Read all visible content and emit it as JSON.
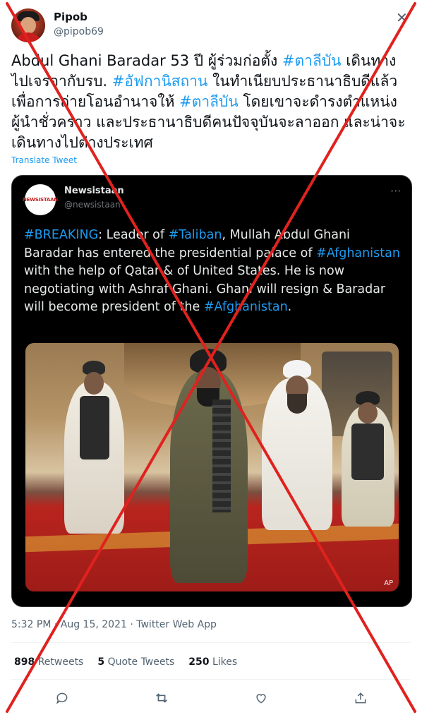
{
  "author": {
    "name": "Pipob",
    "handle": "@pipob69"
  },
  "tweet": {
    "segments": [
      {
        "text": "Abdul Ghani Baradar 53 ปี ผู้ร่วมก่อตั้ง ",
        "tag": false
      },
      {
        "text": "#ตาลีบัน",
        "tag": true
      },
      {
        "text": " เดินทางไปเจรจากับรบ. ",
        "tag": false
      },
      {
        "text": "#อัฟกานิสถาน",
        "tag": true
      },
      {
        "text": " ในทำเนียบประธานาธิบดีแล้ว เพื่อการถ่ายโอนอำนาจให้ ",
        "tag": false
      },
      {
        "text": "#ตาลีบัน",
        "tag": true
      },
      {
        "text": " โดยเขาจะดำรงตำแหน่งผู้นำชั่วคราว และประธานาธิบดีคนปัจจุบันจะลาออก และน่าจะเดินทางไปต่างประเทศ",
        "tag": false
      }
    ],
    "translate_label": "Translate Tweet",
    "timestamp": "5:32 PM · Aug 15, 2021 · Twitter Web App"
  },
  "quoted": {
    "name": "Newsistaan",
    "handle": "@newsistaan",
    "avatar_text": "NEWSISTAAN",
    "segments": [
      {
        "text": "#BREAKING",
        "tag": true
      },
      {
        "text": ": Leader of ",
        "tag": false
      },
      {
        "text": "#Taliban",
        "tag": true
      },
      {
        "text": ", Mullah Abdul Ghani Baradar has entered the presidential palace of ",
        "tag": false
      },
      {
        "text": "#Afghanistan",
        "tag": true
      },
      {
        "text": " with the help of Qatar & of United States. He is now negotiating with Ashraf Ghani. Ghani will resign & Baradar will become president of the ",
        "tag": false
      },
      {
        "text": "#Afghanistan",
        "tag": true
      },
      {
        "text": ".",
        "tag": false
      }
    ],
    "photo_credit": "AP"
  },
  "stats": {
    "retweets_count": "898",
    "retweets_label": "Retweets",
    "quotes_count": "5",
    "quotes_label": "Quote Tweets",
    "likes_count": "250",
    "likes_label": "Likes"
  },
  "icons": [
    "close-icon",
    "more-icon",
    "reply-icon",
    "retweet-icon",
    "like-icon",
    "share-icon"
  ],
  "colors": {
    "hashtag": "#1d9bf0",
    "overlay_cross": "#e0221f",
    "quote_bg": "#000000"
  }
}
